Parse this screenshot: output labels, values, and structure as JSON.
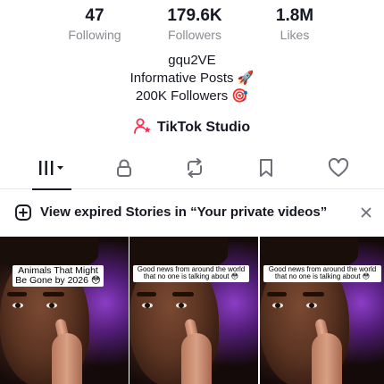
{
  "stats": [
    {
      "value": "47",
      "label": "Following"
    },
    {
      "value": "179.6K",
      "label": "Followers"
    },
    {
      "value": "1.8M",
      "label": "Likes"
    }
  ],
  "profile": {
    "username": "gqu2VE",
    "bio_line_1": "Informative Posts 🚀",
    "bio_line_2": "200K Followers 🎯"
  },
  "studio": {
    "label": "TikTok Studio",
    "icon": "person-star-icon"
  },
  "tabs": [
    {
      "icon": "videos-grid-icon",
      "active": true
    },
    {
      "icon": "lock-icon",
      "active": false
    },
    {
      "icon": "repost-icon",
      "active": false
    },
    {
      "icon": "bookmark-icon",
      "active": false
    },
    {
      "icon": "heart-icon",
      "active": false
    }
  ],
  "banner": {
    "text": "View expired Stories in “Your private videos”",
    "icon": "add-square-icon",
    "close_icon": "close-icon"
  },
  "videos": [
    {
      "caption": "Animals That Might Be Gone by 2026 😳"
    },
    {
      "caption": "Good news from around the world that no one is talking about 😳"
    },
    {
      "caption": "Good news from around the world that no one is talking about 😳"
    }
  ],
  "colors": {
    "text": "#161823",
    "secondary": "#8a8b91",
    "studio_icon": "#fe2c55"
  }
}
